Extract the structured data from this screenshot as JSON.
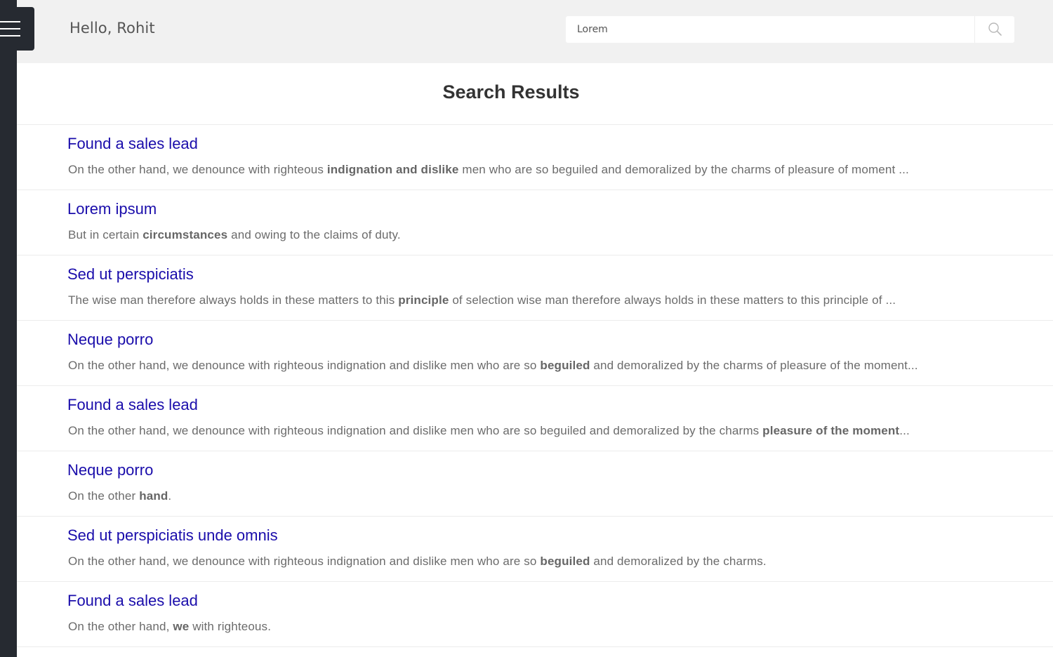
{
  "header": {
    "greeting": "Hello, Rohit",
    "search_value": "Lorem",
    "search_icon": "search-icon",
    "menu_icon": "hamburger-menu-icon"
  },
  "main": {
    "title": "Search Results"
  },
  "results": [
    {
      "title": "Found a sales lead",
      "snippet": {
        "before": "On the other hand, we denounce with righteous ",
        "bold": "indignation and dislike",
        "after": " men who are so beguiled and demoralized by the charms of pleasure of moment ..."
      }
    },
    {
      "title": "Lorem ipsum",
      "snippet": {
        "before": "But in certain ",
        "bold": "circumstances",
        "after": " and owing to the claims of duty."
      }
    },
    {
      "title": "Sed ut perspiciatis",
      "snippet": {
        "before": "The wise man therefore always holds in these matters to this ",
        "bold": "principle",
        "after": " of selection wise man therefore always holds in these matters to this principle of ..."
      }
    },
    {
      "title": "Neque porro",
      "snippet": {
        "before": "On the other hand, we denounce with righteous indignation and dislike men who are so ",
        "bold": "beguiled",
        "after": " and demoralized by the charms of pleasure of the moment..."
      }
    },
    {
      "title": "Found a sales lead",
      "snippet": {
        "before": "On the other hand, we denounce with righteous indignation and dislike men who are so beguiled and demoralized by the charms ",
        "bold": "pleasure of the moment",
        "after": "..."
      }
    },
    {
      "title": "Neque porro",
      "snippet": {
        "before": "On the other ",
        "bold": "hand",
        "after": "."
      }
    },
    {
      "title": "Sed ut perspiciatis unde omnis",
      "snippet": {
        "before": "On the other hand, we denounce with righteous indignation and dislike men who are so ",
        "bold": "beguiled",
        "after": " and demoralized by the charms."
      }
    },
    {
      "title": "Found a sales lead",
      "snippet": {
        "before": "On the other hand, ",
        "bold": "we",
        "after": " with righteous."
      }
    }
  ],
  "colors": {
    "sidebar": "#262a31",
    "topbar": "#f1f1f1",
    "link": "#1a0dab",
    "snippet": "#6b6b6b"
  }
}
